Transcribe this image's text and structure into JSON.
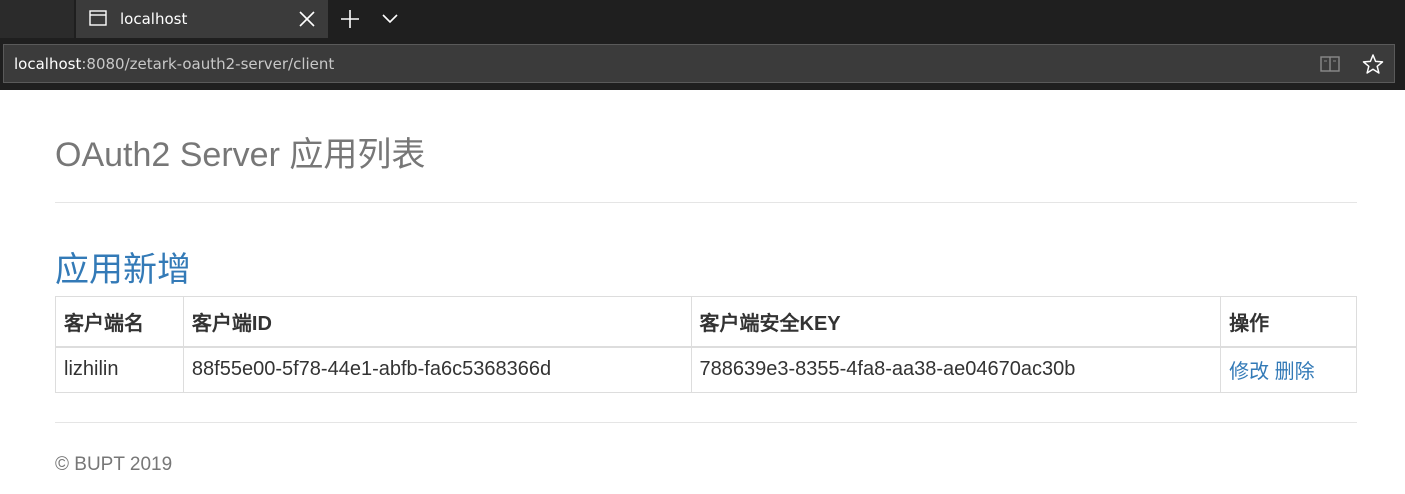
{
  "browser": {
    "tab_title": "localhost",
    "url_host": "localhost",
    "url_path": ":8080/zetark-oauth2-server/client",
    "icons": {
      "tab_page": "page-icon",
      "tab_close": "close-icon",
      "new_tab": "plus-icon",
      "tab_list": "chevron-down-icon",
      "reading_view": "book-icon",
      "favorite": "star-icon"
    }
  },
  "page": {
    "title": "OAuth2 Server 应用列表",
    "add_link": "应用新增",
    "table": {
      "headers": [
        "客户端名",
        "客户端ID",
        "客户端安全KEY",
        "操作"
      ],
      "rows": [
        {
          "name": "lizhilin",
          "client_id": "88f55e00-5f78-44e1-abfb-fa6c5368366d",
          "secret": "788639e3-8355-4fa8-aa38-ae04670ac30b",
          "edit_label": "修改",
          "delete_label": "删除"
        }
      ]
    },
    "footer": "© BUPT 2019"
  },
  "colors": {
    "link": "#337ab7",
    "muted_text": "#777777",
    "chrome_bg": "#1f1f1f",
    "tab_active_bg": "#3b3b3b"
  }
}
